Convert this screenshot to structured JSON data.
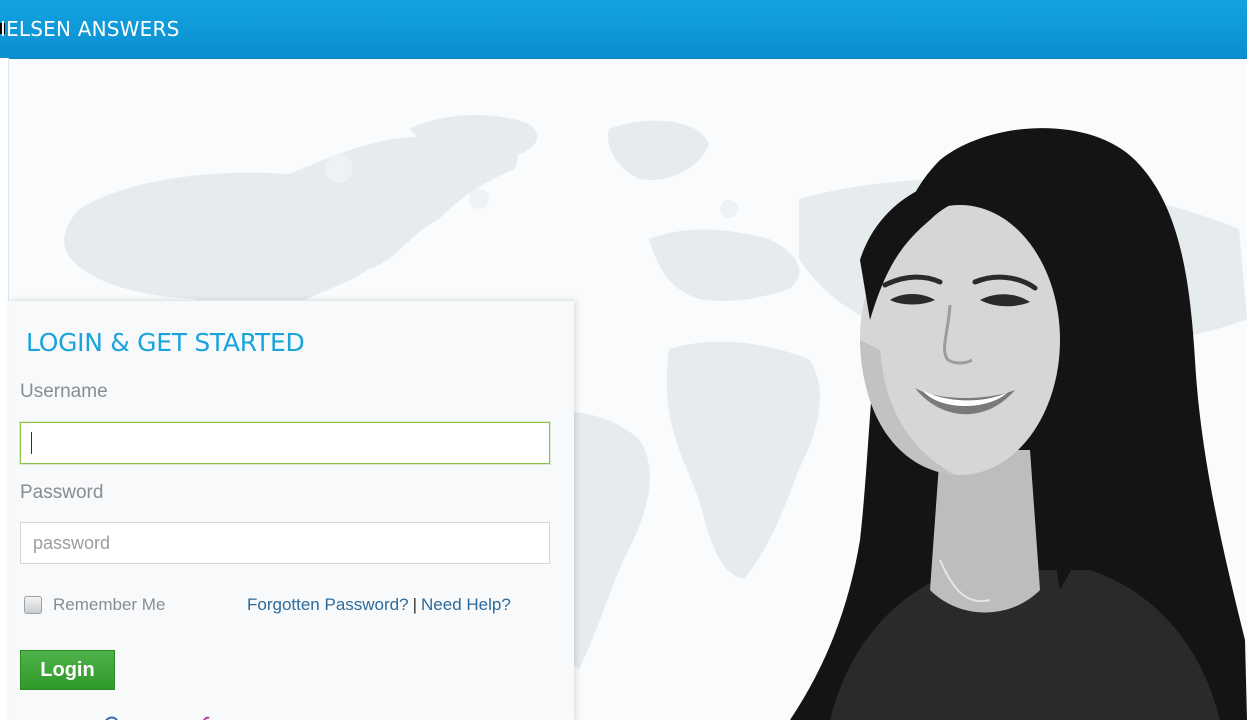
{
  "header": {
    "title": "IELSEN ANSWERS"
  },
  "login": {
    "title": "LOGIN & GET STARTED",
    "username_label": "Username",
    "username_value": "",
    "password_label": "Password",
    "password_placeholder": "password",
    "remember_label": "Remember Me",
    "forgot_link": "Forgotten Password?",
    "separator": "|",
    "help_link": "Need Help?",
    "login_button": "Login"
  },
  "colors": {
    "header_blue": "#0b8fcf",
    "title_blue": "#1ba3dc",
    "link_blue": "#2e6b9b",
    "button_green": "#2f9a2a",
    "focus_green": "#8bc34a"
  },
  "icons": {
    "map": "world-map-image",
    "portrait": "smiling-woman-photo",
    "checkbox": "checkbox-unchecked"
  }
}
